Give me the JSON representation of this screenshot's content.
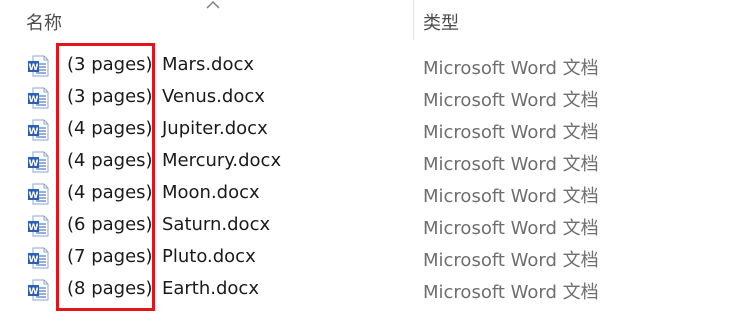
{
  "header": {
    "name_label": "名称",
    "type_label": "类型"
  },
  "files": [
    {
      "pages": "(3 pages)",
      "name": "Mars.docx",
      "type": "Microsoft Word 文档"
    },
    {
      "pages": "(3 pages)",
      "name": "Venus.docx",
      "type": "Microsoft Word 文档"
    },
    {
      "pages": "(4 pages)",
      "name": "Jupiter.docx",
      "type": "Microsoft Word 文档"
    },
    {
      "pages": "(4 pages)",
      "name": "Mercury.docx",
      "type": "Microsoft Word 文档"
    },
    {
      "pages": "(4 pages)",
      "name": "Moon.docx",
      "type": "Microsoft Word 文档"
    },
    {
      "pages": "(6 pages)",
      "name": "Saturn.docx",
      "type": "Microsoft Word 文档"
    },
    {
      "pages": "(7 pages)",
      "name": "Pluto.docx",
      "type": "Microsoft Word 文档"
    },
    {
      "pages": "(8 pages)",
      "name": "Earth.docx",
      "type": "Microsoft Word 文档"
    }
  ],
  "icons": {
    "file_icon": "word-doc-icon",
    "sort_icon": "sort-ascending-caret-icon"
  },
  "colors": {
    "highlight_border": "#e3141a",
    "word_blue": "#2b5fb4"
  }
}
